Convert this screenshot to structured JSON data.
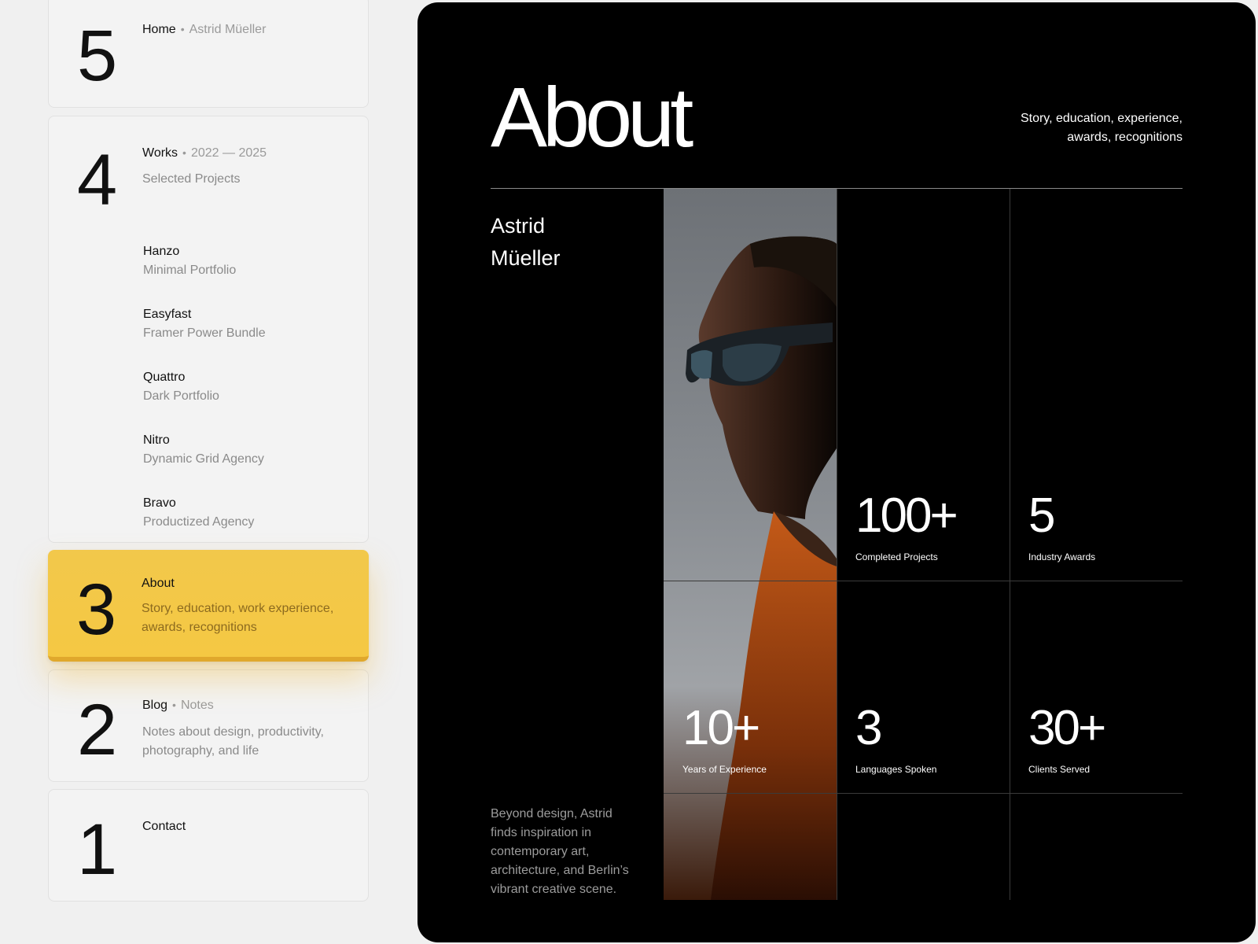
{
  "nav": {
    "home": {
      "number": "5",
      "title": "Home",
      "meta": "Astrid Müeller"
    },
    "works": {
      "number": "4",
      "title": "Works",
      "meta": "2022 — 2025",
      "subtitle": "Selected Projects",
      "projects": [
        {
          "name": "Hanzo",
          "desc": "Minimal Portfolio"
        },
        {
          "name": "Easyfast",
          "desc": "Framer Power Bundle"
        },
        {
          "name": "Quattro",
          "desc": "Dark Portfolio"
        },
        {
          "name": "Nitro",
          "desc": "Dynamic Grid Agency"
        },
        {
          "name": "Bravo",
          "desc": "Productized Agency"
        }
      ]
    },
    "about": {
      "number": "3",
      "title": "About",
      "desc": "Story, education, work experience, awards, recognitions"
    },
    "blog": {
      "number": "2",
      "title": "Blog",
      "meta": "Notes",
      "desc": "Notes about design, productivity, photography, and life"
    },
    "contact": {
      "number": "1",
      "title": "Contact"
    }
  },
  "about_panel": {
    "title": "About",
    "subtitle": "Story, education, experience, awards, recognitions",
    "name_line1": "Astrid",
    "name_line2": "Müeller",
    "bio": "Beyond design, Astrid finds inspiration in contemporary art, architecture, and Berlin’s vibrant creative scene.",
    "stats": [
      {
        "value": "100+",
        "label": "Completed Projects"
      },
      {
        "value": "5",
        "label": "Industry Awards"
      },
      {
        "value": "10+",
        "label": "Years of Experience"
      },
      {
        "value": "3",
        "label": "Languages Spoken"
      },
      {
        "value": "30+",
        "label": "Clients Served"
      }
    ]
  },
  "colors": {
    "accent": "#f5c843",
    "panel_bg": "#000000",
    "page_bg": "#f0f0f0"
  }
}
